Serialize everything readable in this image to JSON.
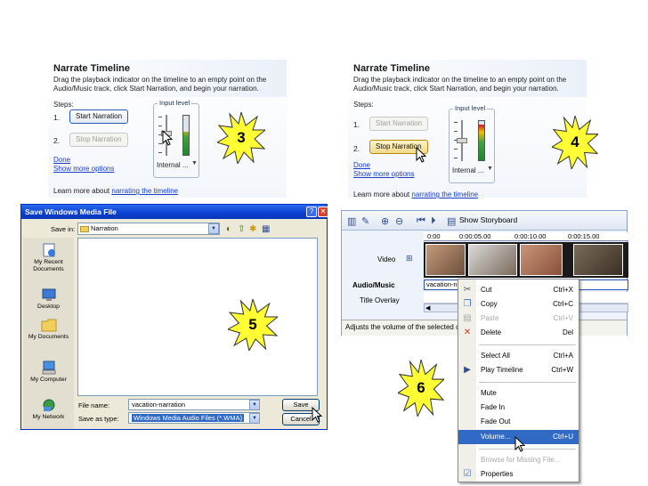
{
  "narrate_a": {
    "title": "Narrate Timeline",
    "description": "Drag the playback indicator on the timeline to an empty point on the Audio/Music track, click Start Narration, and begin your narration.",
    "steps_label": "Steps:",
    "step1": "1.",
    "step2": "2.",
    "start_button": "Start Narration",
    "stop_button": "Stop Narration",
    "input_level_label": "Input level",
    "input_device": "Internal ...",
    "done_link": "Done",
    "more_link": "Show more options",
    "learn_prefix": "Learn more about",
    "learn_link": "narrating the timeline",
    "meter_level": 0.6
  },
  "narrate_b": {
    "title": "Narrate Timeline",
    "description": "Drag the playback indicator on the timeline to an empty point on the Audio/Music track, click Start Narration, and begin your narration.",
    "steps_label": "Steps:",
    "step1": "1.",
    "step2": "2.",
    "start_button": "Start Narration",
    "stop_button": "Stop Narration",
    "input_level_label": "Input level",
    "input_device": "Internal ...",
    "done_link": "Done",
    "more_link": "Show more options",
    "learn_prefix": "Learn more about",
    "learn_link": "narrating the timeline",
    "meter_level": 0.9
  },
  "callouts": {
    "c3": "3",
    "c4": "4",
    "c5": "5",
    "c6": "6"
  },
  "save_dialog": {
    "title": "Save Windows Media File",
    "save_in_label": "Save in:",
    "save_in_value": "Narration",
    "places": [
      "My Recent Documents",
      "Desktop",
      "My Documents",
      "My Computer",
      "My Network"
    ],
    "file_name_label": "File name:",
    "file_name_value": "vacation-narration",
    "save_type_label": "Save as type:",
    "save_type_value": "Windows Media Audio Files (*.WMA)",
    "save_button": "Save",
    "cancel_button": "Cancel"
  },
  "timeline": {
    "show_storyboard": "Show Storyboard",
    "ruler": [
      "0:00",
      "0:00:05.00",
      "0:00:10.00",
      "0:00:15.00"
    ],
    "video_label": "Video",
    "audio_label": "Audio/Music",
    "audio_clip": "vacation-n",
    "overlay_label": "Title Overlay",
    "status": "Adjusts the volume of the selected c"
  },
  "context_menu": {
    "cut": "Cut",
    "cut_sc": "Ctrl+X",
    "copy": "Copy",
    "copy_sc": "Ctrl+C",
    "paste": "Paste",
    "paste_sc": "Ctrl+V",
    "delete": "Delete",
    "delete_sc": "Del",
    "select_all": "Select All",
    "select_all_sc": "Ctrl+A",
    "play_timeline": "Play Timeline",
    "play_timeline_sc": "Ctrl+W",
    "mute": "Mute",
    "fade_in": "Fade In",
    "fade_out": "Fade Out",
    "volume": "Volume...",
    "volume_sc": "Ctrl+U",
    "browse": "Browse for Missing File...",
    "properties": "Properties"
  },
  "colors": {
    "highlight": "#316ac5",
    "link": "#1a3ec7",
    "burst_fill": "#ffff33",
    "title_bar": "#0a3fd0"
  }
}
